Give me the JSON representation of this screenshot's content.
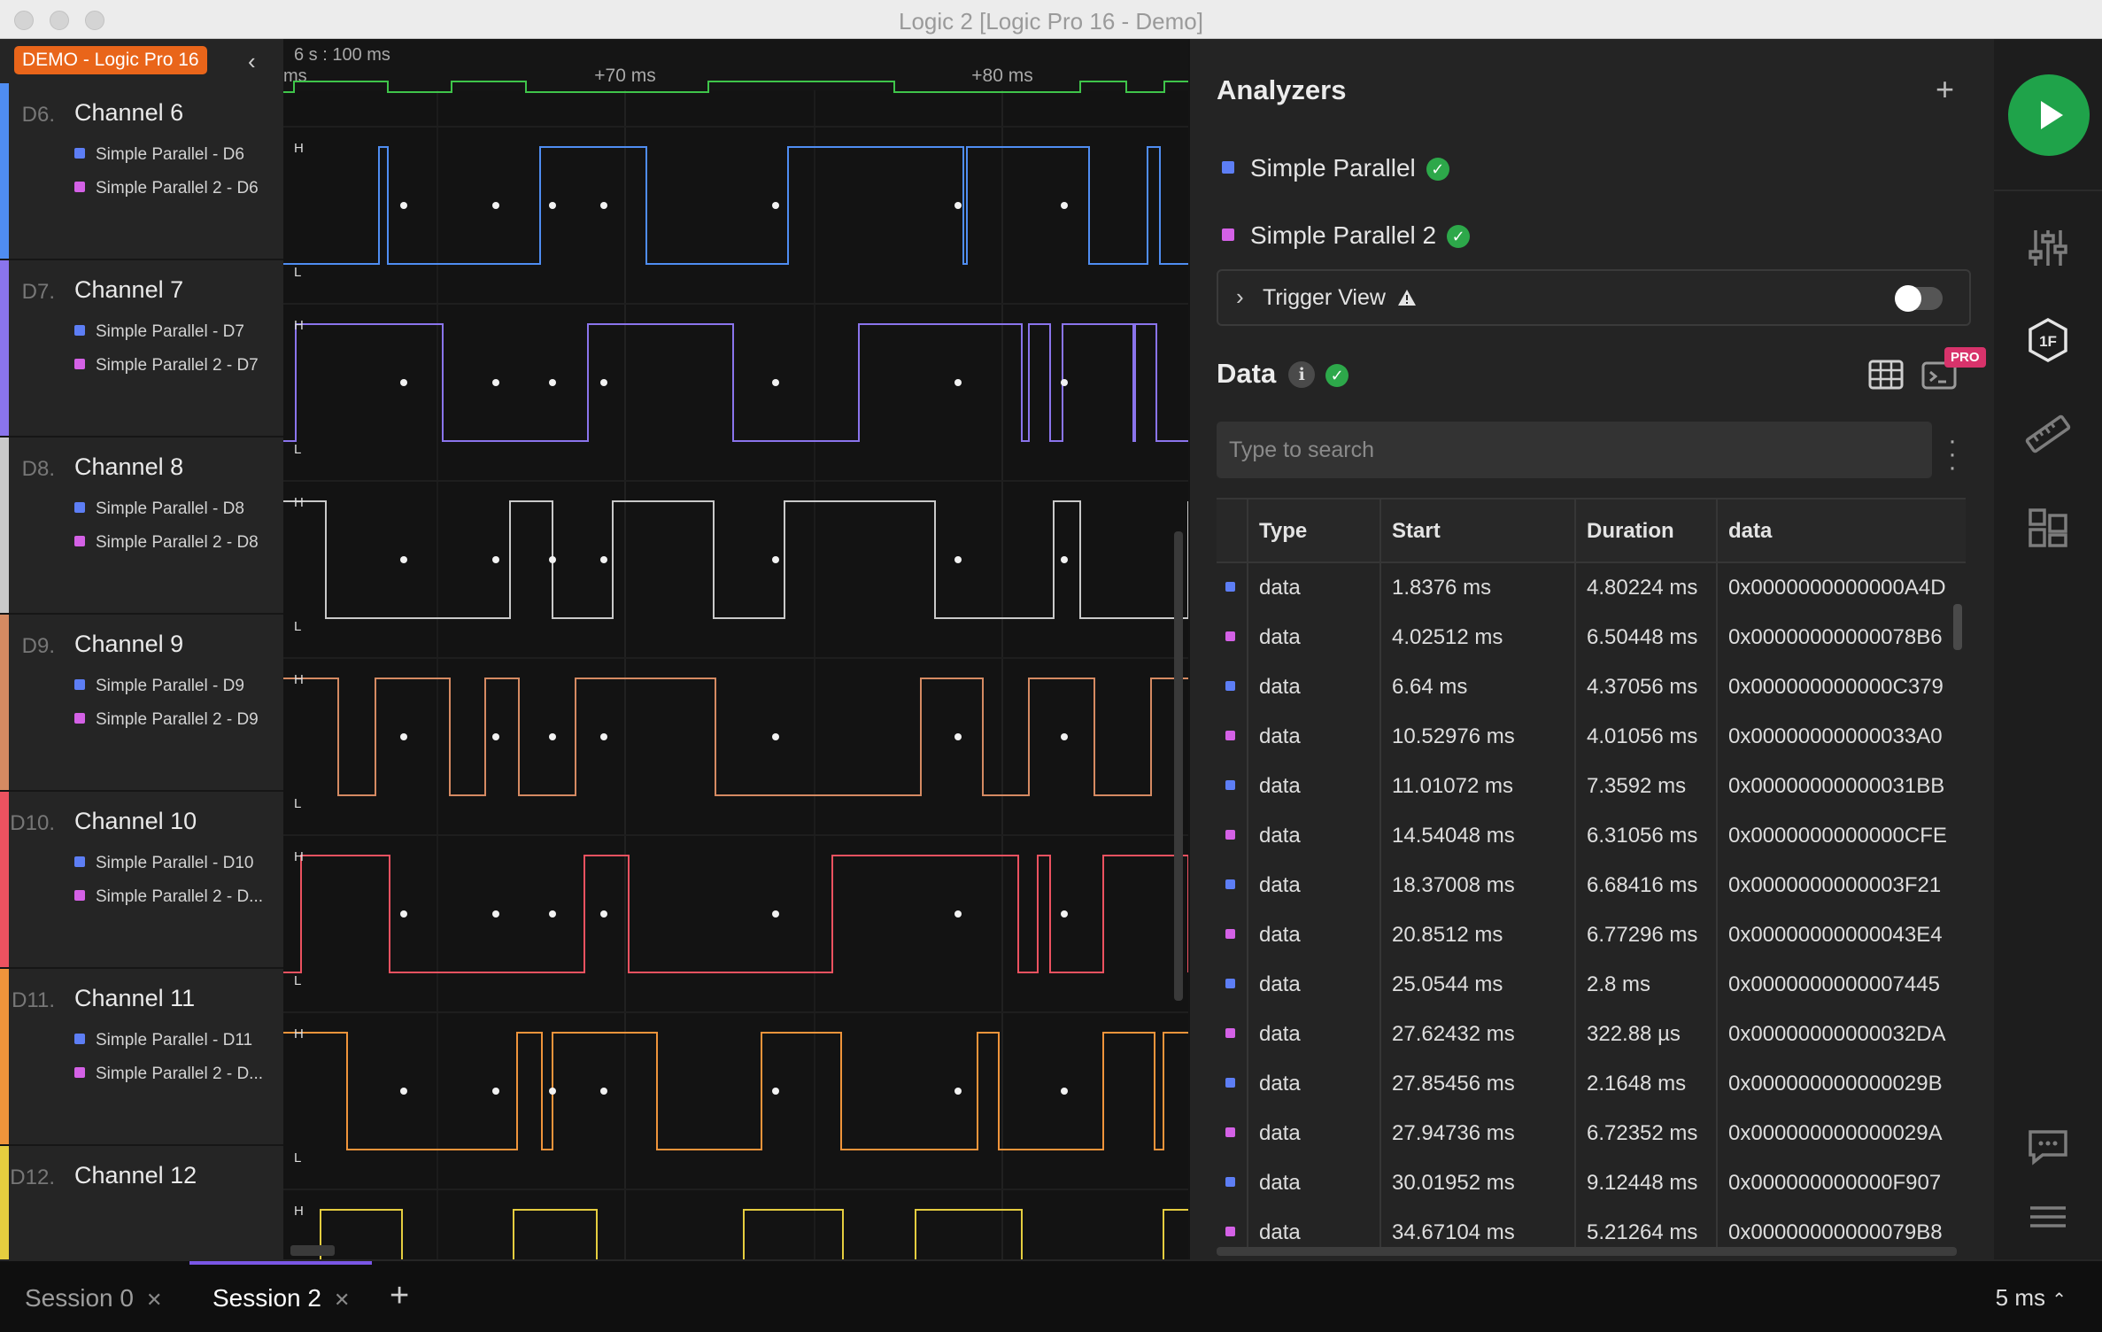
{
  "window": {
    "title": "Logic 2 [Logic Pro 16 - Demo]"
  },
  "device": {
    "badge": "DEMO - Logic Pro 16"
  },
  "timeline": {
    "time_origin": "6 s : 100 ms",
    "left_fragment": "ms",
    "ticks": [
      "+70 ms",
      "+80 ms"
    ]
  },
  "channels": [
    {
      "num": "D6.",
      "name": "Channel 6",
      "color": "#4f8df2",
      "a1": "Simple Parallel - D6",
      "a2": "Simple Parallel 2 - D6"
    },
    {
      "num": "D7.",
      "name": "Channel 7",
      "color": "#8a74ec",
      "a1": "Simple Parallel - D7",
      "a2": "Simple Parallel 2 - D7"
    },
    {
      "num": "D8.",
      "name": "Channel 8",
      "color": "#c9c9c9",
      "a1": "Simple Parallel - D8",
      "a2": "Simple Parallel 2 - D8"
    },
    {
      "num": "D9.",
      "name": "Channel 9",
      "color": "#d58a62",
      "a1": "Simple Parallel - D9",
      "a2": "Simple Parallel 2 - D9"
    },
    {
      "num": "D10.",
      "name": "Channel 10",
      "color": "#ec5260",
      "a1": "Simple Parallel - D10",
      "a2": "Simple Parallel 2 - D..."
    },
    {
      "num": "D11.",
      "name": "Channel 11",
      "color": "#ef943b",
      "a1": "Simple Parallel - D11",
      "a2": "Simple Parallel 2 - D..."
    },
    {
      "num": "D12.",
      "name": "Channel 12",
      "color": "#e5cd3f",
      "a1": "",
      "a2": ""
    }
  ],
  "wave_labels": {
    "high": "H",
    "low": "L"
  },
  "analyzers": {
    "title": "Analyzers",
    "items": [
      {
        "name": "Simple Parallel",
        "color": "#5d7ef5"
      },
      {
        "name": "Simple Parallel 2",
        "color": "#d461e6"
      }
    ]
  },
  "trigger": {
    "label": "Trigger View",
    "warning_icon": "warning-icon",
    "enabled": false
  },
  "data_section": {
    "title": "Data",
    "pro_badge": "PRO",
    "search_placeholder": "Type to search"
  },
  "table": {
    "columns": [
      "Type",
      "Start",
      "Duration",
      "data"
    ],
    "rows": [
      {
        "a": 1,
        "type": "data",
        "start": "1.8376 ms",
        "duration": "4.80224 ms",
        "data": "0x0000000000000A4D"
      },
      {
        "a": 2,
        "type": "data",
        "start": "4.02512 ms",
        "duration": "6.50448 ms",
        "data": "0x00000000000078B6"
      },
      {
        "a": 1,
        "type": "data",
        "start": "6.64 ms",
        "duration": "4.37056 ms",
        "data": "0x000000000000C379"
      },
      {
        "a": 2,
        "type": "data",
        "start": "10.52976 ms",
        "duration": "4.01056 ms",
        "data": "0x00000000000033A0"
      },
      {
        "a": 1,
        "type": "data",
        "start": "11.01072 ms",
        "duration": "7.3592 ms",
        "data": "0x00000000000031BB"
      },
      {
        "a": 2,
        "type": "data",
        "start": "14.54048 ms",
        "duration": "6.31056 ms",
        "data": "0x0000000000000CFE"
      },
      {
        "a": 1,
        "type": "data",
        "start": "18.37008 ms",
        "duration": "6.68416 ms",
        "data": "0x0000000000003F21"
      },
      {
        "a": 2,
        "type": "data",
        "start": "20.8512 ms",
        "duration": "6.77296 ms",
        "data": "0x00000000000043E4"
      },
      {
        "a": 1,
        "type": "data",
        "start": "25.0544 ms",
        "duration": "2.8 ms",
        "data": "0x0000000000007445"
      },
      {
        "a": 2,
        "type": "data",
        "start": "27.62432 ms",
        "duration": "322.88 µs",
        "data": "0x00000000000032DA"
      },
      {
        "a": 1,
        "type": "data",
        "start": "27.85456 ms",
        "duration": "2.1648 ms",
        "data": "0x000000000000029B"
      },
      {
        "a": 2,
        "type": "data",
        "start": "27.94736 ms",
        "duration": "6.72352 ms",
        "data": "0x000000000000029A"
      },
      {
        "a": 1,
        "type": "data",
        "start": "30.01952 ms",
        "duration": "9.12448 ms",
        "data": "0x000000000000F907"
      },
      {
        "a": 2,
        "type": "data",
        "start": "34.67104 ms",
        "duration": "5.21264 ms",
        "data": "0x00000000000079B8"
      }
    ]
  },
  "sessions": {
    "tabs": [
      {
        "label": "Session 0",
        "active": false
      },
      {
        "label": "Session 2",
        "active": true
      }
    ]
  },
  "status": {
    "zoom": "5 ms"
  },
  "colors": {
    "accent": "#7a56e6",
    "play": "#1fa34a",
    "demo": "#e9651a",
    "analyzer1": "#5d7ef5",
    "analyzer2": "#d461e6"
  }
}
